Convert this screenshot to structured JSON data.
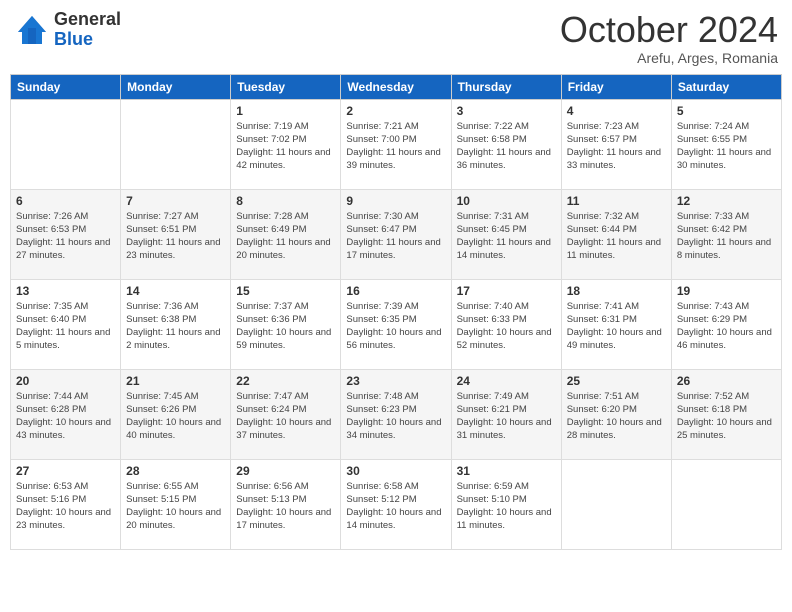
{
  "header": {
    "logo_general": "General",
    "logo_blue": "Blue",
    "month_title": "October 2024",
    "subtitle": "Arefu, Arges, Romania"
  },
  "calendar": {
    "weekdays": [
      "Sunday",
      "Monday",
      "Tuesday",
      "Wednesday",
      "Thursday",
      "Friday",
      "Saturday"
    ],
    "weeks": [
      [
        {
          "day": "",
          "sunrise": "",
          "sunset": "",
          "daylight": ""
        },
        {
          "day": "",
          "sunrise": "",
          "sunset": "",
          "daylight": ""
        },
        {
          "day": "1",
          "sunrise": "Sunrise: 7:19 AM",
          "sunset": "Sunset: 7:02 PM",
          "daylight": "Daylight: 11 hours and 42 minutes."
        },
        {
          "day": "2",
          "sunrise": "Sunrise: 7:21 AM",
          "sunset": "Sunset: 7:00 PM",
          "daylight": "Daylight: 11 hours and 39 minutes."
        },
        {
          "day": "3",
          "sunrise": "Sunrise: 7:22 AM",
          "sunset": "Sunset: 6:58 PM",
          "daylight": "Daylight: 11 hours and 36 minutes."
        },
        {
          "day": "4",
          "sunrise": "Sunrise: 7:23 AM",
          "sunset": "Sunset: 6:57 PM",
          "daylight": "Daylight: 11 hours and 33 minutes."
        },
        {
          "day": "5",
          "sunrise": "Sunrise: 7:24 AM",
          "sunset": "Sunset: 6:55 PM",
          "daylight": "Daylight: 11 hours and 30 minutes."
        }
      ],
      [
        {
          "day": "6",
          "sunrise": "Sunrise: 7:26 AM",
          "sunset": "Sunset: 6:53 PM",
          "daylight": "Daylight: 11 hours and 27 minutes."
        },
        {
          "day": "7",
          "sunrise": "Sunrise: 7:27 AM",
          "sunset": "Sunset: 6:51 PM",
          "daylight": "Daylight: 11 hours and 23 minutes."
        },
        {
          "day": "8",
          "sunrise": "Sunrise: 7:28 AM",
          "sunset": "Sunset: 6:49 PM",
          "daylight": "Daylight: 11 hours and 20 minutes."
        },
        {
          "day": "9",
          "sunrise": "Sunrise: 7:30 AM",
          "sunset": "Sunset: 6:47 PM",
          "daylight": "Daylight: 11 hours and 17 minutes."
        },
        {
          "day": "10",
          "sunrise": "Sunrise: 7:31 AM",
          "sunset": "Sunset: 6:45 PM",
          "daylight": "Daylight: 11 hours and 14 minutes."
        },
        {
          "day": "11",
          "sunrise": "Sunrise: 7:32 AM",
          "sunset": "Sunset: 6:44 PM",
          "daylight": "Daylight: 11 hours and 11 minutes."
        },
        {
          "day": "12",
          "sunrise": "Sunrise: 7:33 AM",
          "sunset": "Sunset: 6:42 PM",
          "daylight": "Daylight: 11 hours and 8 minutes."
        }
      ],
      [
        {
          "day": "13",
          "sunrise": "Sunrise: 7:35 AM",
          "sunset": "Sunset: 6:40 PM",
          "daylight": "Daylight: 11 hours and 5 minutes."
        },
        {
          "day": "14",
          "sunrise": "Sunrise: 7:36 AM",
          "sunset": "Sunset: 6:38 PM",
          "daylight": "Daylight: 11 hours and 2 minutes."
        },
        {
          "day": "15",
          "sunrise": "Sunrise: 7:37 AM",
          "sunset": "Sunset: 6:36 PM",
          "daylight": "Daylight: 10 hours and 59 minutes."
        },
        {
          "day": "16",
          "sunrise": "Sunrise: 7:39 AM",
          "sunset": "Sunset: 6:35 PM",
          "daylight": "Daylight: 10 hours and 56 minutes."
        },
        {
          "day": "17",
          "sunrise": "Sunrise: 7:40 AM",
          "sunset": "Sunset: 6:33 PM",
          "daylight": "Daylight: 10 hours and 52 minutes."
        },
        {
          "day": "18",
          "sunrise": "Sunrise: 7:41 AM",
          "sunset": "Sunset: 6:31 PM",
          "daylight": "Daylight: 10 hours and 49 minutes."
        },
        {
          "day": "19",
          "sunrise": "Sunrise: 7:43 AM",
          "sunset": "Sunset: 6:29 PM",
          "daylight": "Daylight: 10 hours and 46 minutes."
        }
      ],
      [
        {
          "day": "20",
          "sunrise": "Sunrise: 7:44 AM",
          "sunset": "Sunset: 6:28 PM",
          "daylight": "Daylight: 10 hours and 43 minutes."
        },
        {
          "day": "21",
          "sunrise": "Sunrise: 7:45 AM",
          "sunset": "Sunset: 6:26 PM",
          "daylight": "Daylight: 10 hours and 40 minutes."
        },
        {
          "day": "22",
          "sunrise": "Sunrise: 7:47 AM",
          "sunset": "Sunset: 6:24 PM",
          "daylight": "Daylight: 10 hours and 37 minutes."
        },
        {
          "day": "23",
          "sunrise": "Sunrise: 7:48 AM",
          "sunset": "Sunset: 6:23 PM",
          "daylight": "Daylight: 10 hours and 34 minutes."
        },
        {
          "day": "24",
          "sunrise": "Sunrise: 7:49 AM",
          "sunset": "Sunset: 6:21 PM",
          "daylight": "Daylight: 10 hours and 31 minutes."
        },
        {
          "day": "25",
          "sunrise": "Sunrise: 7:51 AM",
          "sunset": "Sunset: 6:20 PM",
          "daylight": "Daylight: 10 hours and 28 minutes."
        },
        {
          "day": "26",
          "sunrise": "Sunrise: 7:52 AM",
          "sunset": "Sunset: 6:18 PM",
          "daylight": "Daylight: 10 hours and 25 minutes."
        }
      ],
      [
        {
          "day": "27",
          "sunrise": "Sunrise: 6:53 AM",
          "sunset": "Sunset: 5:16 PM",
          "daylight": "Daylight: 10 hours and 23 minutes."
        },
        {
          "day": "28",
          "sunrise": "Sunrise: 6:55 AM",
          "sunset": "Sunset: 5:15 PM",
          "daylight": "Daylight: 10 hours and 20 minutes."
        },
        {
          "day": "29",
          "sunrise": "Sunrise: 6:56 AM",
          "sunset": "Sunset: 5:13 PM",
          "daylight": "Daylight: 10 hours and 17 minutes."
        },
        {
          "day": "30",
          "sunrise": "Sunrise: 6:58 AM",
          "sunset": "Sunset: 5:12 PM",
          "daylight": "Daylight: 10 hours and 14 minutes."
        },
        {
          "day": "31",
          "sunrise": "Sunrise: 6:59 AM",
          "sunset": "Sunset: 5:10 PM",
          "daylight": "Daylight: 10 hours and 11 minutes."
        },
        {
          "day": "",
          "sunrise": "",
          "sunset": "",
          "daylight": ""
        },
        {
          "day": "",
          "sunrise": "",
          "sunset": "",
          "daylight": ""
        }
      ]
    ]
  }
}
